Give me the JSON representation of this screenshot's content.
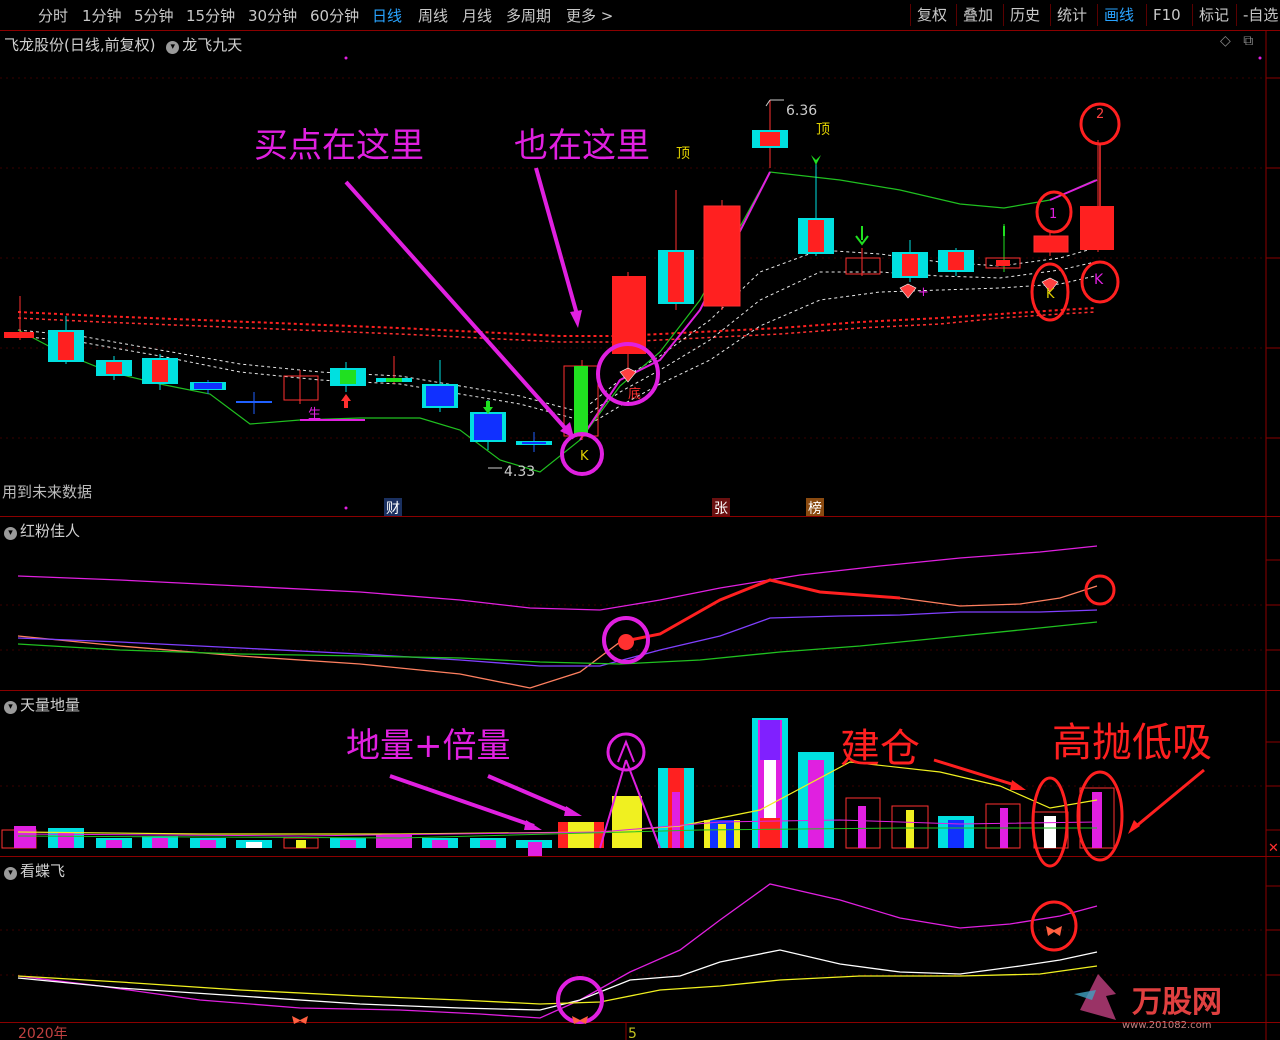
{
  "toolbar": {
    "periods": [
      "分时",
      "1分钟",
      "5分钟",
      "15分钟",
      "30分钟",
      "60分钟",
      "日线",
      "周线",
      "月线",
      "多周期",
      "更多 >"
    ],
    "active_period": "日线",
    "right_items": [
      "复权",
      "叠加",
      "历史",
      "统计",
      "画线",
      "F10",
      "标记",
      "-自选"
    ],
    "active_right": "画线"
  },
  "main_panel": {
    "title": "飞龙股份(日线,前复权)",
    "indicator": "龙飞九天",
    "future_note": "用到未来数据",
    "high_label": "6.36",
    "low_label": "4.33",
    "markers": [
      "财",
      "张",
      "榜"
    ],
    "dash_values": [
      "顶",
      "顶"
    ],
    "glyphs": {
      "bottom": "底",
      "k": "K",
      "sheng": "生"
    }
  },
  "annotations": {
    "buy_here": "买点在这里",
    "also_here": "也在这里",
    "ground_volume": "地量+倍量",
    "build_position": "建仓",
    "sell_high_buy_low": "高抛低吸",
    "circle_1": "1",
    "circle_2": "2"
  },
  "panels": {
    "p2_title": "红粉佳人",
    "p3_title": "天量地量",
    "p4_title": "看蝶飞"
  },
  "footer": {
    "year": "2020年",
    "month": "5",
    "watermark": "万股网",
    "watermark_url": "www.201082.com"
  },
  "colors": {
    "bg": "#000000",
    "up": "#ff0000",
    "down": "#00e0e0",
    "annotation": "#e020e0",
    "annotation_red": "#ff2020",
    "active_tab": "#29a3ff"
  }
}
